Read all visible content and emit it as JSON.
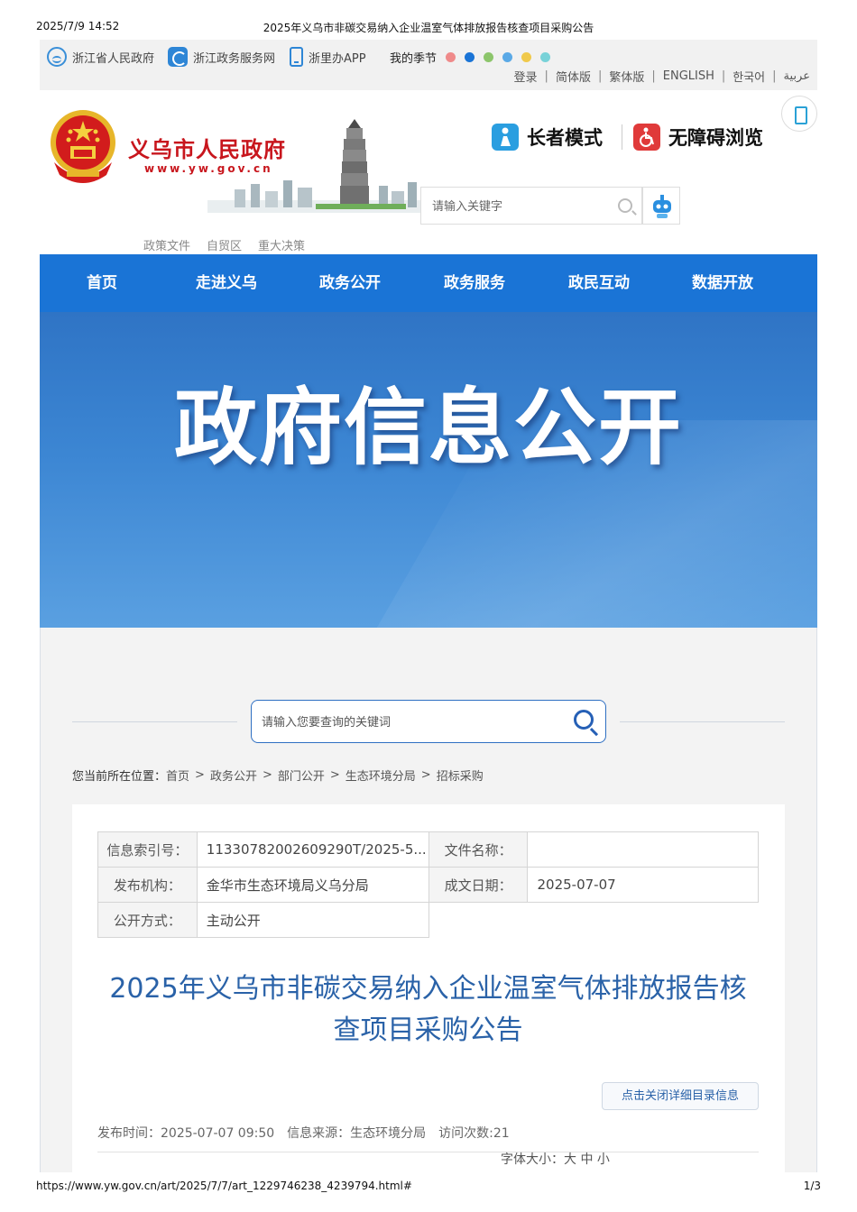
{
  "print_header": {
    "datetime": "2025/7/9 14:52",
    "title": "2025年义乌市非碳交易纳入企业温室气体排放报告核查项目采购公告"
  },
  "topbar": {
    "links": [
      {
        "label": "浙江省人民政府",
        "icon": "zhejiang-gov-icon"
      },
      {
        "label": "浙江政务服务网",
        "icon": "zhejiang-service-icon"
      },
      {
        "label": "浙里办APP",
        "icon": "mobile-app-icon"
      }
    ],
    "season_label": "我的季节",
    "season_colors": [
      "#ef8a8a",
      "#1a74d6",
      "#8cc56b",
      "#5aa9e6",
      "#f0c94b",
      "#78d2d8"
    ],
    "languages": [
      "登录",
      "简体版",
      "繁体版",
      "ENGLISH",
      "한국어",
      "عربية"
    ]
  },
  "header": {
    "site_name": "义乌市人民政府",
    "site_url": "www.yw.gov.cn",
    "elder_mode": "长者模式",
    "accessible_mode": "无障碍浏览",
    "search_placeholder": "请输入关键字"
  },
  "quicklinks": [
    "政策文件",
    "自贸区",
    "重大决策"
  ],
  "nav": [
    "首页",
    "走进义乌",
    "政务公开",
    "政务服务",
    "政民互动",
    "数据开放"
  ],
  "banner": {
    "title": "政府信息公开"
  },
  "main_search": {
    "placeholder": "请输入您要查询的关键词"
  },
  "breadcrumb": {
    "prefix": "您当前所在位置：",
    "items": [
      "首页",
      "政务公开",
      "部门公开",
      "生态环境分局",
      "招标采购"
    ]
  },
  "meta": {
    "index_label": "信息索引号：",
    "index_value": "11330782002609290T/2025-5...",
    "filename_label": "文件名称：",
    "filename_value": "",
    "publisher_label": "发布机构：",
    "publisher_value": "金华市生态环境局义乌分局",
    "date_label": "成文日期：",
    "date_value": "2025-07-07",
    "mode_label": "公开方式：",
    "mode_value": "主动公开"
  },
  "document": {
    "title": "2025年义乌市非碳交易纳入企业温室气体排放报告核查项目采购公告",
    "toggle_label": "点击关闭详细目录信息",
    "publish_time": "发布时间：2025-07-07 09:50",
    "source": "信息来源：生态环境分局",
    "visits": "访问次数:21",
    "font_size": "字体大小：大 中 小"
  },
  "print_footer": {
    "url": "https://www.yw.gov.cn/art/2025/7/7/art_1229746238_4239794.html#",
    "page": "1/3"
  }
}
